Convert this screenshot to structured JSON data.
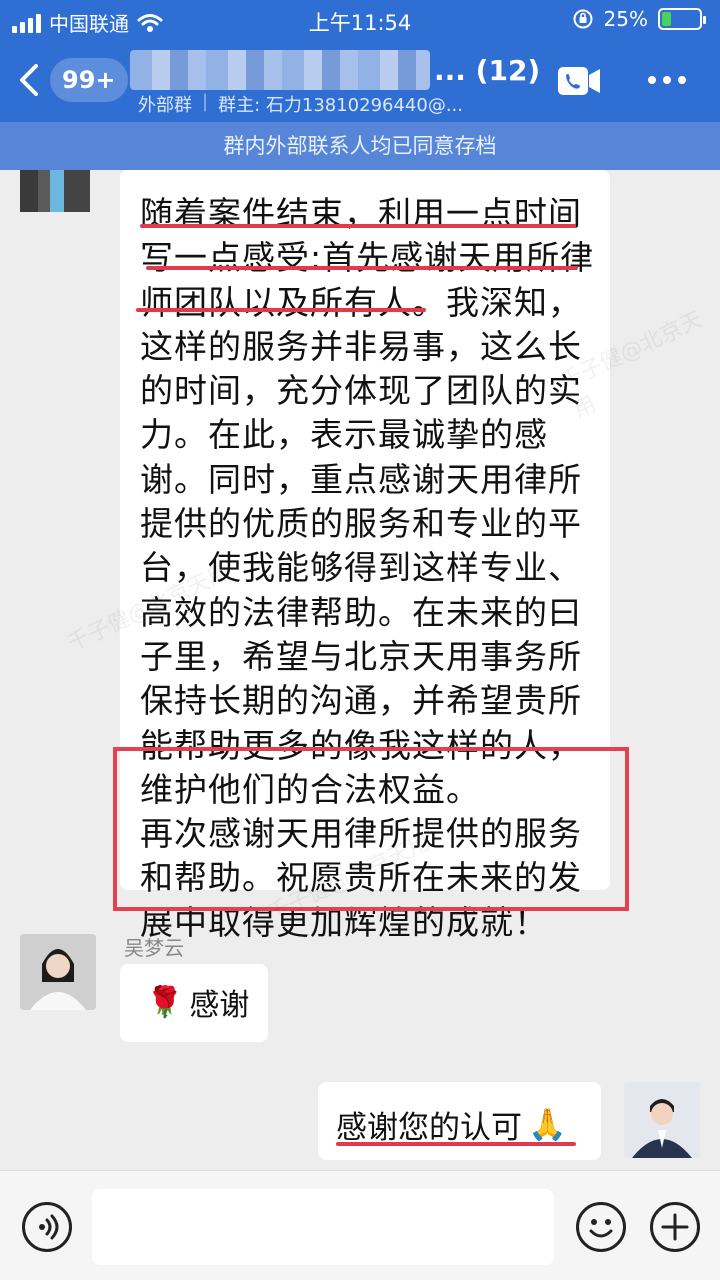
{
  "status_bar": {
    "carrier": "中国联通",
    "time": "上午11:54",
    "battery": "25%",
    "battery_level": 0.25
  },
  "header": {
    "back_badge": "99+",
    "title_suffix": "... (12)",
    "group_type": "外部群",
    "owner": "群主: 石力13810296440@...",
    "notice": "群内外部联系人均已同意存档"
  },
  "messages": {
    "long_message_lines": [
      "随着案件结束，利用一点时间",
      "写一点感受:首先感谢天用所律",
      "师团队以及所有人。我深知，",
      "这样的服务并非易事，这么长",
      "的时间，充分体现了团队的实",
      "力。在此，表示最诚挚的感",
      "谢。同时，重点感谢天用律所",
      "提供的优质的服务和专业的平",
      "台，使我能够得到这样专业、",
      "高效的法律帮助。在未来的曰",
      "子里，希望与北京天用事务所",
      "保持长期的沟通，并希望贵所",
      "能帮助更多的像我这样的人，",
      "维护他们的合法权益。",
      "再次感谢天用律所提供的服务",
      "和帮助。祝愿贵所在未来的发",
      "展中取得更加辉煌的成就！"
    ],
    "reply1": {
      "sender": "吴梦云",
      "text": "感谢",
      "emoji": "🌹"
    },
    "reply2": {
      "text": "感谢您的认可",
      "emoji": "🙏"
    }
  },
  "watermark": "千子健@北京天用",
  "icons": {
    "back": "chevron-left-icon",
    "call": "video-call-icon",
    "more": "more-dots-icon",
    "voice": "voice-icon",
    "emoji": "emoji-icon",
    "add": "plus-icon"
  },
  "colors": {
    "header": "#2f6fd3",
    "notice": "#5786d9",
    "highlight": "#e03a4b"
  }
}
